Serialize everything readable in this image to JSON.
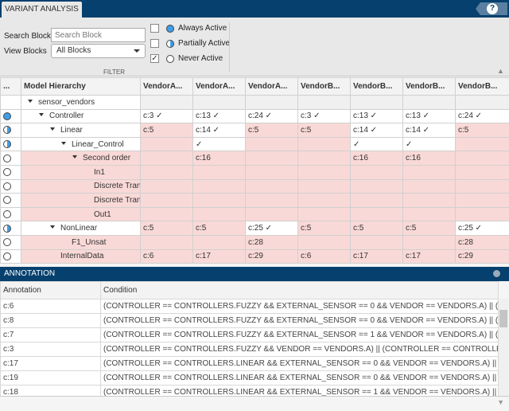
{
  "tab": {
    "title": "VARIANT ANALYSIS"
  },
  "filter": {
    "search_label": "Search Blocks",
    "search_placeholder": "Search Block",
    "view_label": "View Blocks",
    "view_value": "All Blocks",
    "section_label": "FILTER",
    "options": [
      {
        "label": "Always Active",
        "checked": false,
        "icon": "always-active-icon"
      },
      {
        "label": "Partially Active",
        "checked": false,
        "icon": "partially-active-icon"
      },
      {
        "label": "Never Active",
        "checked": true,
        "icon": "never-active-icon"
      }
    ]
  },
  "grid": {
    "columns": [
      "...",
      "Model Hierarchy",
      "VendorA...",
      "VendorA...",
      "VendorA...",
      "VendorB...",
      "VendorB...",
      "VendorB...",
      "VendorB..."
    ],
    "rows": [
      {
        "status": "none",
        "name": "sensor_vendors",
        "level": 0,
        "expand": true,
        "name_pink": false,
        "cells": [
          [
            "",
            ""
          ],
          [
            "",
            ""
          ],
          [
            "",
            ""
          ],
          [
            "",
            ""
          ],
          [
            "",
            ""
          ],
          [
            "",
            ""
          ],
          [
            "",
            ""
          ]
        ]
      },
      {
        "status": "always",
        "name": "Controller",
        "level": 1,
        "expand": true,
        "name_pink": false,
        "cells": [
          [
            "c:3 ✓",
            "w"
          ],
          [
            "c:13 ✓",
            "w"
          ],
          [
            "c:24 ✓",
            "w"
          ],
          [
            "c:3 ✓",
            "w"
          ],
          [
            "c:13 ✓",
            "w"
          ],
          [
            "c:13 ✓",
            "w"
          ],
          [
            "c:24 ✓",
            "w"
          ]
        ]
      },
      {
        "status": "partial",
        "name": "Linear",
        "level": 2,
        "expand": true,
        "name_pink": false,
        "cells": [
          [
            "c:5",
            "p"
          ],
          [
            "c:14 ✓",
            "w"
          ],
          [
            "c:5",
            "p"
          ],
          [
            "c:5",
            "p"
          ],
          [
            "c:14 ✓",
            "w"
          ],
          [
            "c:14 ✓",
            "w"
          ],
          [
            "c:5",
            "p"
          ]
        ]
      },
      {
        "status": "partial",
        "name": "Linear_Control",
        "level": 3,
        "expand": true,
        "name_pink": false,
        "cells": [
          [
            "",
            "p"
          ],
          [
            "✓",
            "w"
          ],
          [
            "",
            "p"
          ],
          [
            "",
            "p"
          ],
          [
            "✓",
            "w"
          ],
          [
            "✓",
            "w"
          ],
          [
            "",
            "p"
          ]
        ]
      },
      {
        "status": "never",
        "name": "Second order",
        "level": 4,
        "expand": true,
        "name_pink": true,
        "cells": [
          [
            "",
            "p"
          ],
          [
            "c:16",
            "p"
          ],
          [
            "",
            "p"
          ],
          [
            "",
            "p"
          ],
          [
            "c:16",
            "p"
          ],
          [
            "c:16",
            "p"
          ],
          [
            "",
            "p"
          ]
        ]
      },
      {
        "status": "never",
        "name": "In1",
        "level": 5,
        "expand": false,
        "name_pink": true,
        "cells": [
          [
            "",
            "p"
          ],
          [
            "",
            "p"
          ],
          [
            "",
            "p"
          ],
          [
            "",
            "p"
          ],
          [
            "",
            "p"
          ],
          [
            "",
            "p"
          ],
          [
            "",
            "p"
          ]
        ]
      },
      {
        "status": "never",
        "name": "Discrete Trans",
        "level": 5,
        "expand": false,
        "name_pink": true,
        "cells": [
          [
            "",
            "p"
          ],
          [
            "",
            "p"
          ],
          [
            "",
            "p"
          ],
          [
            "",
            "p"
          ],
          [
            "",
            "p"
          ],
          [
            "",
            "p"
          ],
          [
            "",
            "p"
          ]
        ]
      },
      {
        "status": "never",
        "name": "Discrete Trans",
        "level": 5,
        "expand": false,
        "name_pink": true,
        "cells": [
          [
            "",
            "p"
          ],
          [
            "",
            "p"
          ],
          [
            "",
            "p"
          ],
          [
            "",
            "p"
          ],
          [
            "",
            "p"
          ],
          [
            "",
            "p"
          ],
          [
            "",
            "p"
          ]
        ]
      },
      {
        "status": "never",
        "name": "Out1",
        "level": 5,
        "expand": false,
        "name_pink": true,
        "cells": [
          [
            "",
            "p"
          ],
          [
            "",
            "p"
          ],
          [
            "",
            "p"
          ],
          [
            "",
            "p"
          ],
          [
            "",
            "p"
          ],
          [
            "",
            "p"
          ],
          [
            "",
            "p"
          ]
        ]
      },
      {
        "status": "partial",
        "name": "NonLinear",
        "level": 2,
        "expand": true,
        "name_pink": false,
        "cells": [
          [
            "c:5",
            "p"
          ],
          [
            "c:5",
            "p"
          ],
          [
            "c:25 ✓",
            "w"
          ],
          [
            "c:5",
            "p"
          ],
          [
            "c:5",
            "p"
          ],
          [
            "c:5",
            "p"
          ],
          [
            "c:25 ✓",
            "w"
          ]
        ]
      },
      {
        "status": "never",
        "name": "F1_Unsat",
        "level": 3,
        "expand": false,
        "name_pink": true,
        "cells": [
          [
            "",
            "p"
          ],
          [
            "",
            "p"
          ],
          [
            "c:28",
            "p"
          ],
          [
            "",
            "p"
          ],
          [
            "",
            "p"
          ],
          [
            "",
            "p"
          ],
          [
            "c:28",
            "p"
          ]
        ]
      },
      {
        "status": "never",
        "name": "InternalData",
        "level": 2,
        "expand": false,
        "name_pink": true,
        "cells": [
          [
            "c:6",
            "p"
          ],
          [
            "c:17",
            "p"
          ],
          [
            "c:29",
            "p"
          ],
          [
            "c:6",
            "p"
          ],
          [
            "c:17",
            "p"
          ],
          [
            "c:17",
            "p"
          ],
          [
            "c:29",
            "p"
          ]
        ]
      }
    ]
  },
  "annotation": {
    "title": "ANNOTATION",
    "columns": [
      "Annotation",
      "Condition"
    ],
    "rows": [
      [
        "c:6",
        "(CONTROLLER == CONTROLLERS.FUZZY && EXTERNAL_SENSOR == 0 && VENDOR == VENDORS.A) || (CON"
      ],
      [
        "c:8",
        "(CONTROLLER == CONTROLLERS.FUZZY && EXTERNAL_SENSOR == 0 && VENDOR == VENDORS.A) || (CON"
      ],
      [
        "c:7",
        "(CONTROLLER == CONTROLLERS.FUZZY && EXTERNAL_SENSOR == 1 && VENDOR == VENDORS.A) || (CON"
      ],
      [
        "c:3",
        "(CONTROLLER == CONTROLLERS.FUZZY && VENDOR == VENDORS.A) || (CONTROLLER == CONTROLLERS."
      ],
      [
        "c:17",
        "(CONTROLLER == CONTROLLERS.LINEAR && EXTERNAL_SENSOR == 0 && VENDOR == VENDORS.A) || (CON"
      ],
      [
        "c:19",
        "(CONTROLLER == CONTROLLERS.LINEAR && EXTERNAL_SENSOR == 0 && VENDOR == VENDORS.A) || (CON"
      ],
      [
        "c:18",
        "(CONTROLLER == CONTROLLERS.LINEAR && EXTERNAL_SENSOR == 1 && VENDOR == VENDORS.A) || (CON"
      ]
    ]
  },
  "colors": {
    "header": "#05406e",
    "pink": "#f9d9d7",
    "active_blue": "#3f9ee8"
  }
}
